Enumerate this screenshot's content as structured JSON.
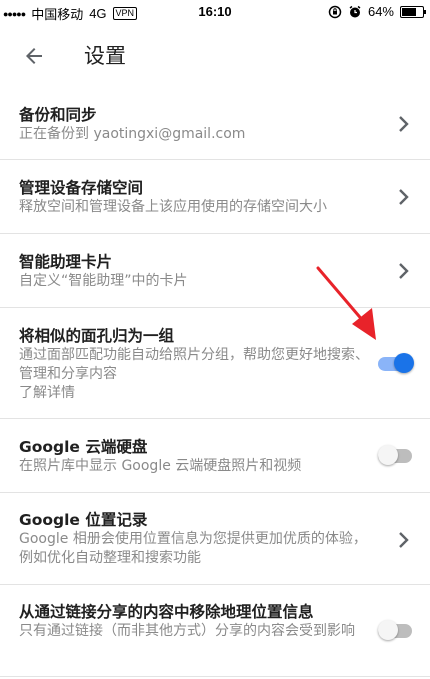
{
  "status_bar": {
    "signal": "●●●●●",
    "carrier": "中国移动",
    "network": "4G",
    "vpn": "VPN",
    "time": "16:10",
    "battery_percent": "64%",
    "battery_level": 0.64
  },
  "header": {
    "title": "设置"
  },
  "settings": [
    {
      "title": "备份和同步",
      "subtitle": "正在备份到 yaotingxi@gmail.com",
      "control": "chevron"
    },
    {
      "title": "管理设备存储空间",
      "subtitle": "释放空间和管理设备上该应用使用的存储空间大小",
      "control": "chevron"
    },
    {
      "title": "智能助理卡片",
      "subtitle": "自定义“智能助理”中的卡片",
      "control": "chevron"
    },
    {
      "title": "将相似的面孔归为一组",
      "subtitle": "通过面部匹配功能自动给照片分组，帮助您更好地搜索、管理和分享内容",
      "link": "了解详情",
      "control": "toggle",
      "on": true
    },
    {
      "title": "Google 云端硬盘",
      "subtitle": "在照片库中显示 Google 云端硬盘照片和视频",
      "control": "toggle",
      "on": false
    },
    {
      "title": "Google 位置记录",
      "subtitle": "Google 相册会使用位置信息为您提供更加优质的体验，例如优化自动整理和搜索功能",
      "control": "chevron"
    },
    {
      "title": "从通过链接分享的内容中移除地理位置信息",
      "subtitle": "只有通过链接（而非其他方式）分享的内容会受到影响",
      "control": "toggle",
      "on": false
    }
  ],
  "colors": {
    "accent": "#1a73e8",
    "annotation_arrow": "#e8232a"
  }
}
